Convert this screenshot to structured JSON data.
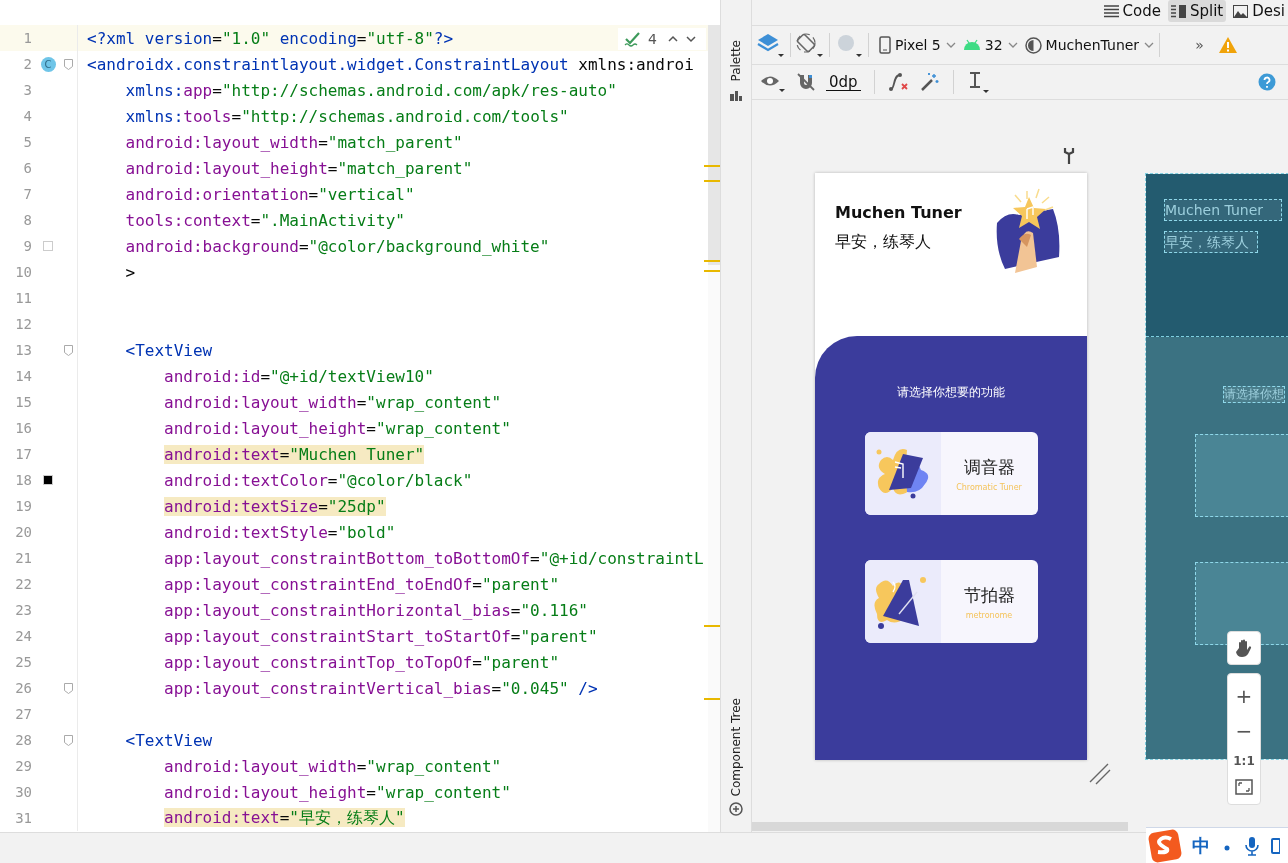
{
  "editor": {
    "inspection": {
      "count": "4"
    },
    "lines": [
      {
        "n": "1",
        "text": "<?xml version=\"1.0\" encoding=\"utf-8\"?>",
        "current": true,
        "highlighted": false,
        "fold": false
      },
      {
        "n": "2",
        "text": "<androidx.constraintlayout.widget.ConstraintLayout xmlns:androi",
        "current": false,
        "highlighted": false,
        "fold": true,
        "gutter": {
          "kind": "class",
          "text": "C"
        }
      },
      {
        "n": "3",
        "text": "    xmlns:app=\"http://schemas.android.com/apk/res-auto\"",
        "current": false,
        "highlighted": false,
        "fold": false
      },
      {
        "n": "4",
        "text": "    xmlns:tools=\"http://schemas.android.com/tools\"",
        "current": false,
        "highlighted": false,
        "fold": false
      },
      {
        "n": "5",
        "text": "    android:layout_width=\"match_parent\"",
        "current": false,
        "highlighted": false,
        "fold": false
      },
      {
        "n": "6",
        "text": "    android:layout_height=\"match_parent\"",
        "current": false,
        "highlighted": false,
        "fold": false
      },
      {
        "n": "7",
        "text": "    android:orientation=\"vertical\"",
        "current": false,
        "highlighted": false,
        "fold": false
      },
      {
        "n": "8",
        "text": "    tools:context=\".MainActivity\"",
        "current": false,
        "highlighted": false,
        "fold": false
      },
      {
        "n": "9",
        "text": "    android:background=\"@color/background_white\"",
        "current": false,
        "highlighted": false,
        "fold": false,
        "gutter": {
          "kind": "swatch",
          "color": "#ffffff"
        }
      },
      {
        "n": "10",
        "text": "    >",
        "current": false,
        "highlighted": false,
        "fold": false
      },
      {
        "n": "11",
        "current": false,
        "fold": false
      },
      {
        "n": "12",
        "current": false,
        "fold": false
      },
      {
        "n": "13",
        "text": "    <TextView",
        "current": false,
        "highlighted": false,
        "fold": true
      },
      {
        "n": "14",
        "text": "        android:id=\"@+id/textView10\"",
        "current": false,
        "highlighted": false,
        "fold": false
      },
      {
        "n": "15",
        "text": "        android:layout_width=\"wrap_content\"",
        "current": false,
        "highlighted": false,
        "fold": false
      },
      {
        "n": "16",
        "text": "        android:layout_height=\"wrap_content\"",
        "current": false,
        "highlighted": false,
        "fold": false
      },
      {
        "n": "17",
        "text": "        android:text=\"Muchen Tuner\"",
        "current": false,
        "highlighted": true,
        "fold": false
      },
      {
        "n": "18",
        "text": "        android:textColor=\"@color/black\"",
        "current": false,
        "highlighted": false,
        "fold": false,
        "gutter": {
          "kind": "swatch",
          "color": "#000000"
        }
      },
      {
        "n": "19",
        "text": "        android:textSize=\"25dp\"",
        "current": false,
        "highlighted": true,
        "fold": false
      },
      {
        "n": "20",
        "text": "        android:textStyle=\"bold\"",
        "current": false,
        "highlighted": false,
        "fold": false
      },
      {
        "n": "21",
        "text": "        app:layout_constraintBottom_toBottomOf=\"@+id/constraintL",
        "current": false,
        "highlighted": false,
        "fold": false
      },
      {
        "n": "22",
        "text": "        app:layout_constraintEnd_toEndOf=\"parent\"",
        "current": false,
        "highlighted": false,
        "fold": false
      },
      {
        "n": "23",
        "text": "        app:layout_constraintHorizontal_bias=\"0.116\"",
        "current": false,
        "highlighted": false,
        "fold": false
      },
      {
        "n": "24",
        "text": "        app:layout_constraintStart_toStartOf=\"parent\"",
        "current": false,
        "highlighted": false,
        "fold": false
      },
      {
        "n": "25",
        "text": "        app:layout_constraintTop_toTopOf=\"parent\"",
        "current": false,
        "highlighted": false,
        "fold": false
      },
      {
        "n": "26",
        "text": "        app:layout_constraintVertical_bias=\"0.045\" />",
        "current": false,
        "highlighted": false,
        "fold": true
      },
      {
        "n": "27",
        "current": false,
        "fold": false
      },
      {
        "n": "28",
        "text": "    <TextView",
        "current": false,
        "highlighted": false,
        "fold": true
      },
      {
        "n": "29",
        "text": "        android:layout_width=\"wrap_content\"",
        "current": false,
        "highlighted": false,
        "fold": false
      },
      {
        "n": "30",
        "text": "        android:layout_height=\"wrap_content\"",
        "current": false,
        "highlighted": false,
        "fold": false
      },
      {
        "n": "31",
        "text": "        android:text=\"早安，练琴人\"",
        "current": false,
        "highlighted": true,
        "fold": false
      }
    ]
  },
  "side_strip": {
    "top": "Palette",
    "bottom": "Component Tree"
  },
  "view_tabs": [
    {
      "label": "Code",
      "selected": false
    },
    {
      "label": "Split",
      "selected": true
    },
    {
      "label": "Desi",
      "selected": false
    }
  ],
  "toolbar": {
    "device": "Pixel 5",
    "api": "32",
    "theme": "MuchenTuner",
    "overflow": "»",
    "margin": "0dp"
  },
  "phone": {
    "title": "Muchen Tuner",
    "greeting": "早安，练琴人",
    "prompt": "请选择你想要的功能",
    "cards": [
      {
        "title": "调音器",
        "subtitle": "Chromatic Tuner"
      },
      {
        "title": "节拍器",
        "subtitle": "metronome"
      }
    ]
  },
  "blueprint": {
    "title": "Muchen Tuner",
    "greeting": "早安，练琴人",
    "prompt": "请选择你想"
  },
  "zoom_controls": {
    "zoom_in": "+",
    "zoom_out": "−",
    "actual": "1:1"
  },
  "ime": {
    "mode": "中"
  }
}
